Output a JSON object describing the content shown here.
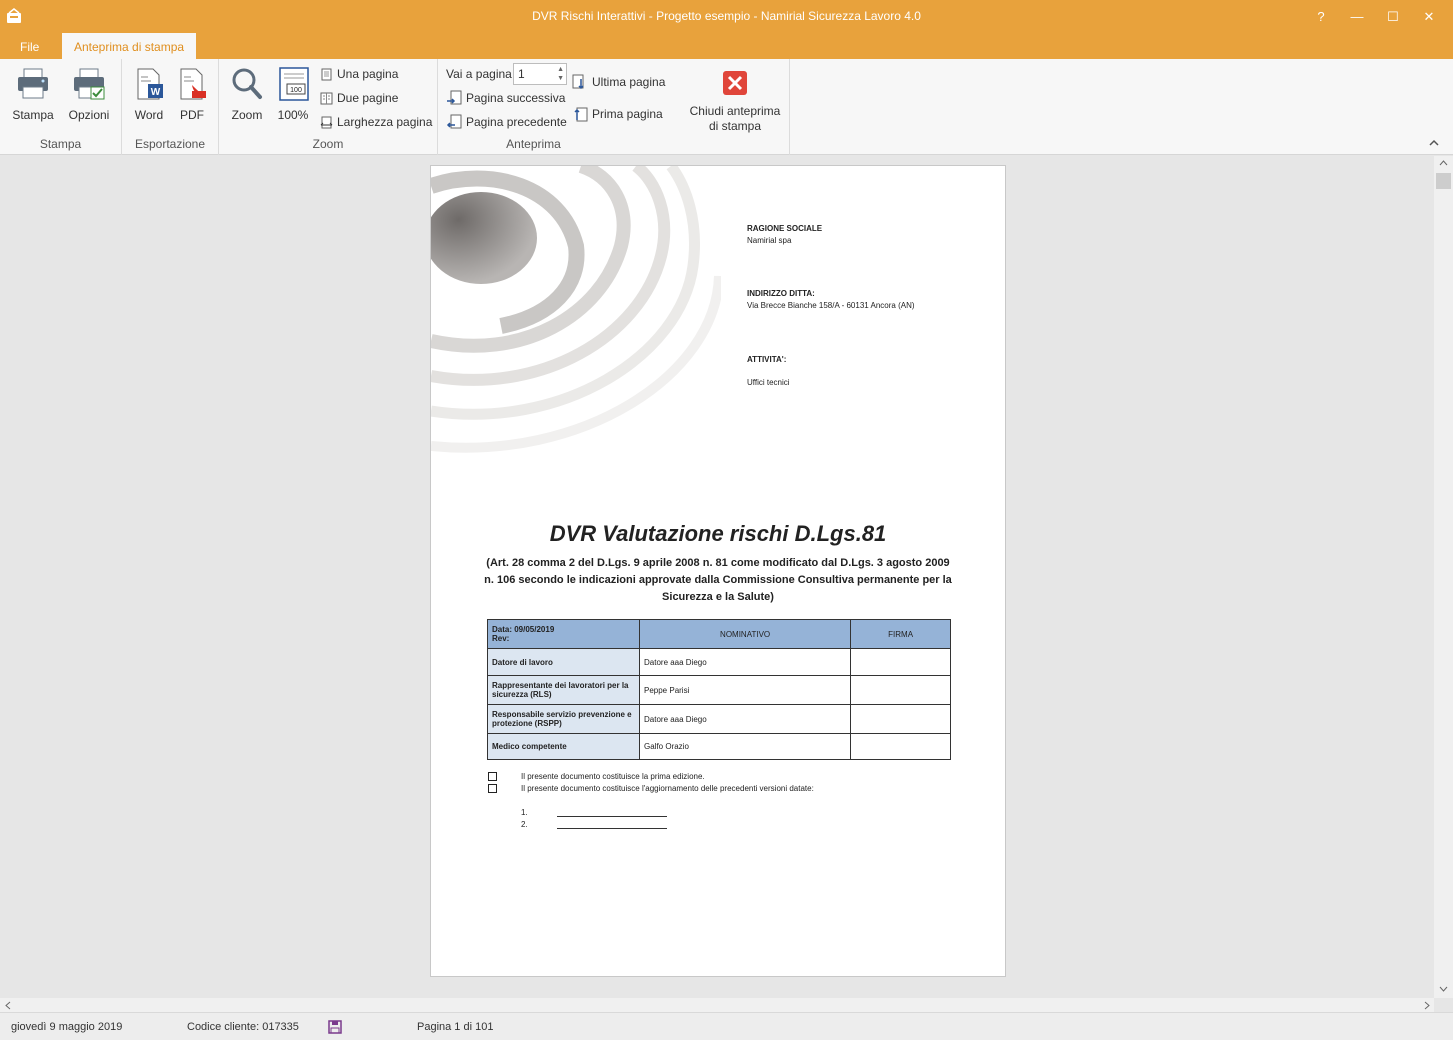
{
  "window": {
    "title": "DVR Rischi Interattivi - Progetto esempio - Namirial Sicurezza Lavoro 4.0",
    "help_label": "?",
    "minimize_label": "—",
    "maximize_label": "☐",
    "close_label": "✕"
  },
  "tabs": [
    {
      "label": "File"
    },
    {
      "label": "Anteprima di stampa"
    }
  ],
  "ribbon": {
    "stampa": {
      "group_label": "Stampa",
      "stampa_label": "Stampa",
      "opzioni_label": "Opzioni"
    },
    "esportazione": {
      "group_label": "Esportazione",
      "word_label": "Word",
      "pdf_label": "PDF"
    },
    "zoom": {
      "group_label": "Zoom",
      "zoom_label": "Zoom",
      "pct_label": "100%",
      "una_pagina": "Una pagina",
      "due_pagine": "Due pagine",
      "larghezza_pagina": "Larghezza pagina"
    },
    "anteprima": {
      "group_label": "Anteprima",
      "vai_a_pagina": "Vai a pagina",
      "page_value": "1",
      "pagina_successiva": "Pagina successiva",
      "pagina_precedente": "Pagina precedente",
      "ultima_pagina": "Ultima pagina",
      "prima_pagina": "Prima pagina"
    },
    "chiudi": {
      "line1": "Chiudi anteprima",
      "line2": "di stampa"
    }
  },
  "document": {
    "ragione_sociale_label": "RAGIONE SOCIALE",
    "ragione_sociale_value": "Namirial spa",
    "indirizzo_label": "INDIRIZZO DITTA:",
    "indirizzo_value": "Via Brecce Bianche 158/A - 60131 Ancora (AN)",
    "attivita_label": "ATTIVITA':",
    "attivita_value": "Uffici tecnici",
    "title": "DVR Valutazione rischi D.Lgs.81",
    "subtitle": "(Art. 28 comma 2 del D.Lgs. 9 aprile 2008 n. 81 come modificato dal D.Lgs. 3 agosto 2009 n. 106 secondo le indicazioni approvate dalla Commissione Consultiva permanente per la Sicurezza e la Salute)",
    "table": {
      "head_date": "Data: 09/05/2019",
      "head_rev": "Rev:",
      "head_nominativo": "NOMINATIVO",
      "head_firma": "FIRMA",
      "rows": [
        {
          "role": "Datore di lavoro",
          "name": "Datore aaa Diego"
        },
        {
          "role": "Rappresentante dei lavoratori per la sicurezza (RLS)",
          "name": "Peppe Parisi"
        },
        {
          "role": "Responsabile servizio prevenzione e protezione (RSPP)",
          "name": "Datore aaa Diego"
        },
        {
          "role": "Medico competente",
          "name": "Galfo Orazio"
        }
      ]
    },
    "check1": "Il presente documento costituisce la prima edizione.",
    "check2": "Il presente documento costituisce l'aggiornamento delle precedenti versioni datate:",
    "item1": "1.",
    "item2": "2."
  },
  "status": {
    "date": "giovedì 9 maggio 2019",
    "codice": "Codice cliente: 017335",
    "pagina": "Pagina 1 di 101"
  },
  "colors": {
    "accent": "#e8a23c",
    "table_head": "#95b3d7",
    "table_row": "#dce6f1",
    "close_red": "#e0453a"
  }
}
